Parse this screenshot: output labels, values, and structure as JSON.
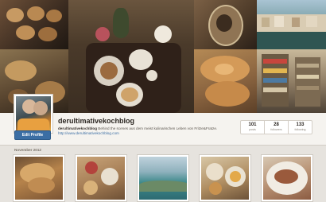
{
  "profile": {
    "username": "derultimativekochblog",
    "edit_label": "Edit Profile",
    "bio_name": "derultimativekochblog",
    "bio_text": " Behind the scenes aus dem meist kulinarischen Leben von Fritze&Fratze. ",
    "bio_link": "http://www.derultimativekochblog.com"
  },
  "stats": [
    {
      "value": "101",
      "label": "posts"
    },
    {
      "value": "28",
      "label": "followers"
    },
    {
      "value": "133",
      "label": "following"
    }
  ],
  "timeline": {
    "month_label": "November 2012"
  }
}
